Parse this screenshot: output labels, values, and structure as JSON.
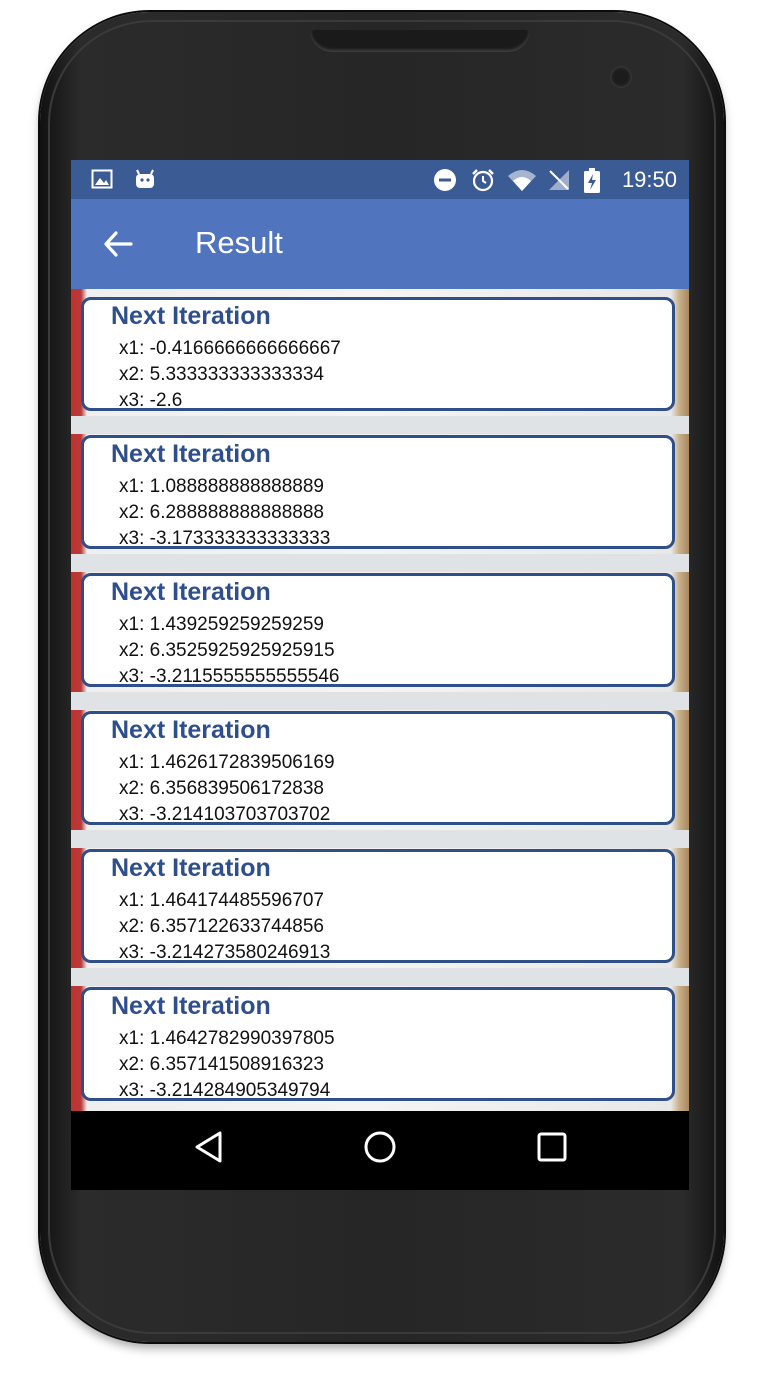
{
  "status_bar": {
    "time": "19:50",
    "left_icons": [
      "image-icon",
      "android-icon"
    ],
    "right_icons": [
      "do-not-disturb-icon",
      "alarm-icon",
      "wifi-icon",
      "no-signal-icon",
      "battery-charging-icon"
    ]
  },
  "app_bar": {
    "title": "Result",
    "back_icon": "arrow-back-icon",
    "background": "#5174be"
  },
  "iterations": [
    {
      "title": "Next Iteration",
      "x1": "x1: -0.4166666666666667",
      "x2": "x2: 5.333333333333334",
      "x3": "x3: -2.6"
    },
    {
      "title": "Next Iteration",
      "x1": "x1: 1.088888888888889",
      "x2": "x2: 6.288888888888888",
      "x3": "x3: -3.173333333333333"
    },
    {
      "title": "Next Iteration",
      "x1": "x1: 1.439259259259259",
      "x2": "x2: 6.3525925925925915",
      "x3": "x3: -3.2115555555555546"
    },
    {
      "title": "Next Iteration",
      "x1": "x1: 1.4626172839506169",
      "x2": "x2: 6.356839506172838",
      "x3": "x3: -3.214103703703702"
    },
    {
      "title": "Next Iteration",
      "x1": "x1: 1.464174485596707",
      "x2": "x2: 6.357122633744856",
      "x3": "x3: -3.214273580246913"
    },
    {
      "title": "Next Iteration",
      "x1": "x1: 1.4642782990397805",
      "x2": "x2: 6.357141508916323",
      "x3": "x3: -3.214284905349794"
    }
  ],
  "nav_bar": {
    "buttons": [
      "back-triangle-icon",
      "home-circle-icon",
      "recents-square-icon"
    ]
  },
  "colors": {
    "status_bar": "#3b5b95",
    "card_border": "#2f4f89",
    "card_title": "#2e4f8c"
  }
}
